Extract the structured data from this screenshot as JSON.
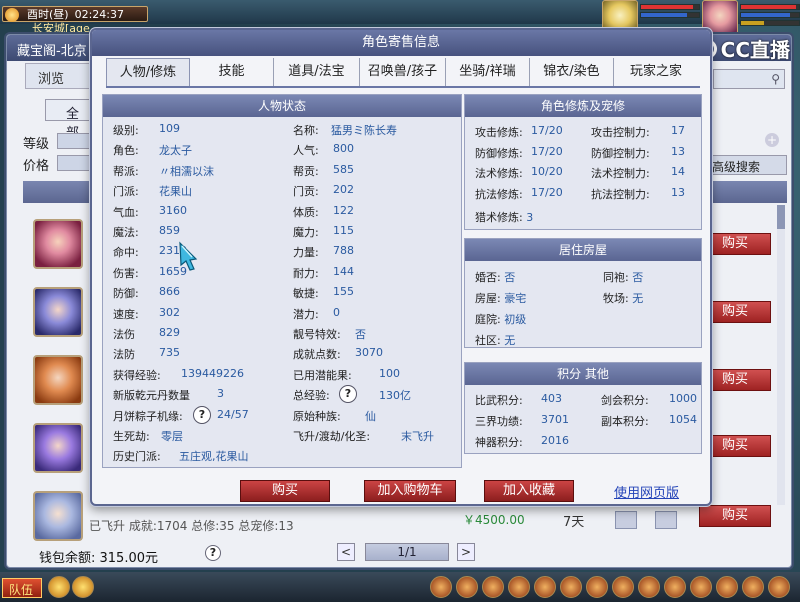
{
  "hud": {
    "clock_period": "酉时(昼)",
    "clock_time": "02:24:37",
    "map_name": "长安城[age",
    "cc_logo": "CC直播"
  },
  "shop": {
    "title": "藏宝阁-北京",
    "browse_tab": "浏览",
    "all_button": "全 部",
    "level_label": "等级",
    "price_label": "价格",
    "search_icon": "search-icon",
    "advanced_search": "高级搜索",
    "buy_label": "购买",
    "row_text": "已飞升 成就:1704 总修:35 总宠修:13",
    "row_price": "￥4500.00",
    "row_days": "7天",
    "wallet": "钱包余额: 315.00元",
    "help": "?",
    "prev": "<",
    "next": ">",
    "page": "1/1"
  },
  "taskbar": {
    "team": "队伍"
  },
  "dialog": {
    "title": "角色寄售信息",
    "tabs": [
      "人物/修炼",
      "技能",
      "道具/法宝",
      "召唤兽/孩子",
      "坐骑/祥瑞",
      "锦衣/染色",
      "玩家之家"
    ],
    "status": {
      "title": "人物状态",
      "left": [
        {
          "k": "级别:",
          "v": "109"
        },
        {
          "k": "角色:",
          "v": "龙太子"
        },
        {
          "k": "帮派:",
          "v": "〃相濡以沫"
        },
        {
          "k": "门派:",
          "v": "花果山"
        },
        {
          "k": "气血:",
          "v": "3160"
        },
        {
          "k": "魔法:",
          "v": "859"
        },
        {
          "k": "命中:",
          "v": "2319"
        },
        {
          "k": "伤害:",
          "v": "1659"
        },
        {
          "k": "防御:",
          "v": "866"
        },
        {
          "k": "速度:",
          "v": "302"
        },
        {
          "k": "法伤",
          "v": "829"
        },
        {
          "k": "法防",
          "v": "735"
        }
      ],
      "right": [
        {
          "k": "名称:",
          "v": "猛男ミ陈长寿"
        },
        {
          "k": "人气:",
          "v": "800"
        },
        {
          "k": "帮贡:",
          "v": "585"
        },
        {
          "k": "门贡:",
          "v": "202"
        },
        {
          "k": "体质:",
          "v": "122"
        },
        {
          "k": "魔力:",
          "v": "115"
        },
        {
          "k": "力量:",
          "v": "788"
        },
        {
          "k": "耐力:",
          "v": "144"
        },
        {
          "k": "敏捷:",
          "v": "155"
        },
        {
          "k": "潜力:",
          "v": "0"
        },
        {
          "k": "靓号特效:",
          "v": "否"
        },
        {
          "k": "成就点数:",
          "v": "3070"
        }
      ],
      "exp_label": "获得经验:",
      "exp": "139449226",
      "potential_label": "已用潜能果:",
      "potential": "100",
      "pill_label": "新版乾元丹数量",
      "pill": "3",
      "total_exp_label": "总经验:",
      "total_exp": "130亿",
      "zongzi_label": "月饼粽子机缘:",
      "zongzi": "24/57",
      "race_label": "原始种族:",
      "race": "仙",
      "life_label": "生死劫:",
      "life": "零层",
      "fly_label": "飞升/渡劫/化圣:",
      "fly": "末飞升",
      "history_label": "历史门派:",
      "history": "五庄观,花果山",
      "help": "?"
    },
    "cultivation": {
      "title": "角色修炼及宠修",
      "rows": [
        {
          "k1": "攻击修炼:",
          "v1": "17/20",
          "k2": "攻击控制力:",
          "v2": "17"
        },
        {
          "k1": "防御修炼:",
          "v1": "17/20",
          "k2": "防御控制力:",
          "v2": "13"
        },
        {
          "k1": "法术修炼:",
          "v1": "10/20",
          "k2": "法术控制力:",
          "v2": "14"
        },
        {
          "k1": "抗法修炼:",
          "v1": "17/20",
          "k2": "抗法控制力:",
          "v2": "13"
        }
      ],
      "hunt_label": "猎术修炼:",
      "hunt": "3"
    },
    "house": {
      "title": "居住房屋",
      "marry_label": "婚否:",
      "marry": "否",
      "robe_label": "同袍:",
      "robe": "否",
      "house_label": "房屋:",
      "house": "豪宅",
      "ranch_label": "牧场:",
      "ranch": "无",
      "yard_label": "庭院:",
      "yard": "初级",
      "community_label": "社区:",
      "community": "无"
    },
    "points": {
      "title": "积分 其他",
      "rows": [
        {
          "k1": "比武积分:",
          "v1": "403",
          "k2": "剑会积分:",
          "v2": "1000"
        },
        {
          "k1": "三界功绩:",
          "v1": "3701",
          "k2": "副本积分:",
          "v2": "1054"
        },
        {
          "k1": "神器积分:",
          "v1": "2016",
          "k2": "",
          "v2": ""
        }
      ]
    },
    "buttons": {
      "buy": "购买",
      "add_cart": "加入购物车",
      "add_fav": "加入收藏",
      "web": "使用网页版"
    }
  }
}
